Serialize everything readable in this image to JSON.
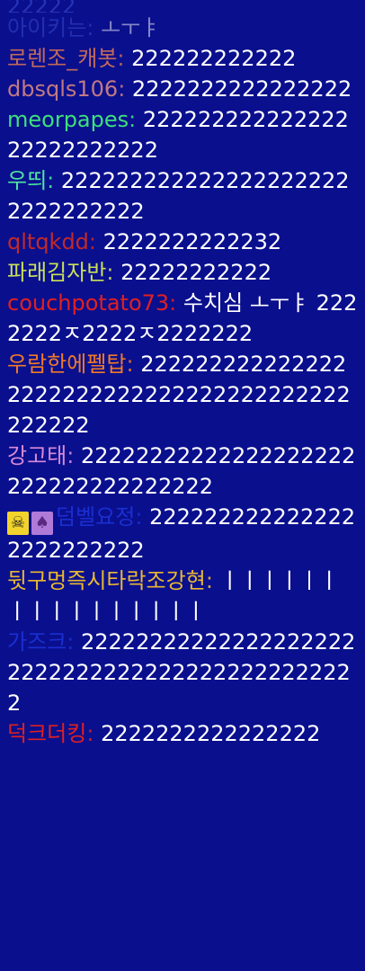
{
  "top_partial": "22222",
  "messages": [
    {
      "nick": "아이키는",
      "sep": ":",
      "text": "ㅗㅜㅑ",
      "color": "#3b4fd6",
      "faded": true
    },
    {
      "nick": "로렌조_캐봇",
      "sep": ":",
      "text": "222222222222",
      "color": "#c06a5a"
    },
    {
      "nick": "dbsqls106",
      "sep": ":",
      "text": "2222222222222222",
      "color": "#c17a82"
    },
    {
      "nick": "meorpapes",
      "sep": ":",
      "text": "22222222222222222222222222",
      "color": "#3ee07a"
    },
    {
      "nick": "우띄",
      "sep": ":",
      "text": "2222222222222222222222222222222",
      "color": "#4ee6a2"
    },
    {
      "nick": "qltqkdd",
      "sep": ":",
      "text": "2222222222232",
      "color": "#c02a2a"
    },
    {
      "nick": "파래김자반",
      "sep": ":",
      "text": "22222222222",
      "color": "#c8e05a"
    },
    {
      "nick": "couchpotato73",
      "sep": ":",
      "text": "수치심 ㅗㅜㅑ 2222222ㅈ2222ㅈ2222222",
      "color": "#e02020"
    },
    {
      "nick": "우람한에펠탑",
      "sep": ":",
      "text": "2222222222222222222222222222222222222222222222",
      "color": "#f07a28"
    },
    {
      "nick": "강고태",
      "sep": ":",
      "text": "22222222222222222222222222222222222",
      "color": "#d88ad8"
    },
    {
      "nick": "덤벨요정",
      "sep": ":",
      "text": "2222222222222222222222222",
      "color": "#1a2fd0",
      "badges": [
        "skull",
        "spade"
      ]
    },
    {
      "nick": "뒷구멍즉시타락조강현",
      "sep": ":",
      "text": "ㅣㅣㅣㅣㅣㅣㅣㅣㅣㅣㅣㅣㅣㅣㅣㅣ",
      "color": "#e8b830"
    },
    {
      "nick": "가즈크",
      "sep": ":",
      "text": "2222222222222222222222222222222222222222222222",
      "color": "#1a2fd0"
    },
    {
      "nick": "덕크더킹",
      "sep": ":",
      "text": "2222222222222222",
      "color": "#e02020"
    }
  ],
  "badge_icons": {
    "skull": "☠",
    "spade": "♠"
  }
}
